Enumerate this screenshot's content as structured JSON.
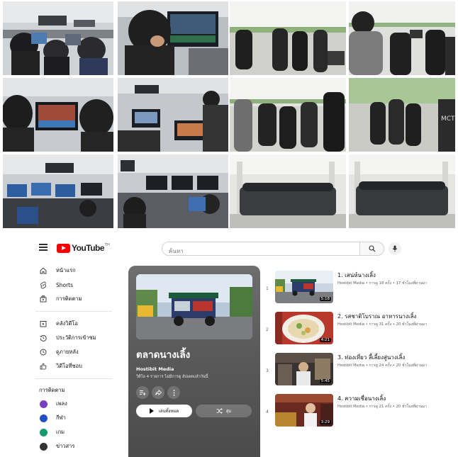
{
  "colors": {
    "brand_red": "#ff0000",
    "playlist_bg": "#5a5a5a",
    "text_primary": "#0f0f0f",
    "text_secondary": "#606060"
  },
  "masthead": {
    "logo_text": "YouTube",
    "logo_tm": "TH",
    "search_placeholder": "ค้นหา",
    "icons": [
      "menu-icon",
      "search-icon",
      "mic-icon"
    ]
  },
  "sidebar": {
    "primary": [
      {
        "label": "หน้าแรก",
        "icon": "home-icon"
      },
      {
        "label": "Shorts",
        "icon": "shorts-icon"
      },
      {
        "label": "การติดตาม",
        "icon": "subscriptions-icon"
      }
    ],
    "library": [
      {
        "label": "คลังวิดีโอ",
        "icon": "library-icon"
      },
      {
        "label": "ประวัติการเข้าชม",
        "icon": "history-icon"
      },
      {
        "label": "ดูภายหลัง",
        "icon": "clock-icon"
      },
      {
        "label": "วิดีโอที่ชอบ",
        "icon": "like-icon"
      }
    ],
    "subscriptions_heading": "การติดตาม",
    "subscriptions": [
      {
        "label": "เพลง",
        "color": "#7b3fc4"
      },
      {
        "label": "กีฬา",
        "color": "#1f4fc9"
      },
      {
        "label": "เกม",
        "color": "#159a6c"
      },
      {
        "label": "ข่าวสาร",
        "color": "#333333"
      }
    ]
  },
  "playlist": {
    "title": "ตลาดนางเลิ้ง",
    "channel": "Hostibit Media",
    "meta": "วิดีโอ 4 รายการ   ไม่มีการดู   อัปเดตแล้ววันนี้",
    "play_all": "เล่นทั้งหมด",
    "shuffle": "สุ่ม"
  },
  "videos": [
    {
      "index": "1",
      "title": "1. เสน่ห์นางเลิ้ง",
      "meta": "Hostibit Media • การดู 18 ครั้ง • 17 ชั่วโมงที่ผ่านมา",
      "duration": "5:18"
    },
    {
      "index": "2",
      "title": "2. รสชาติโบราณ อาหารนางเลิ้ง",
      "meta": "Hostibit Media • การดู 31 ครั้ง • 20 ชั่วโมงที่ผ่านมา",
      "duration": "4:21"
    },
    {
      "index": "3",
      "title": "3. ท่องเที่ยว ลี้เลี้ยงสู่นางเลิ้ง",
      "meta": "Hostibit Media • การดู 24 ครั้ง • 20 ชั่วโมงที่ผ่านมา",
      "duration": "5:45"
    },
    {
      "index": "4",
      "title": "4. ความเชื่อนางเลิ้ง",
      "meta": "Hostibit Media • การดู 21 ครั้ง • 20 ชั่วโมงที่ผ่านมา",
      "duration": "3:29"
    }
  ]
}
